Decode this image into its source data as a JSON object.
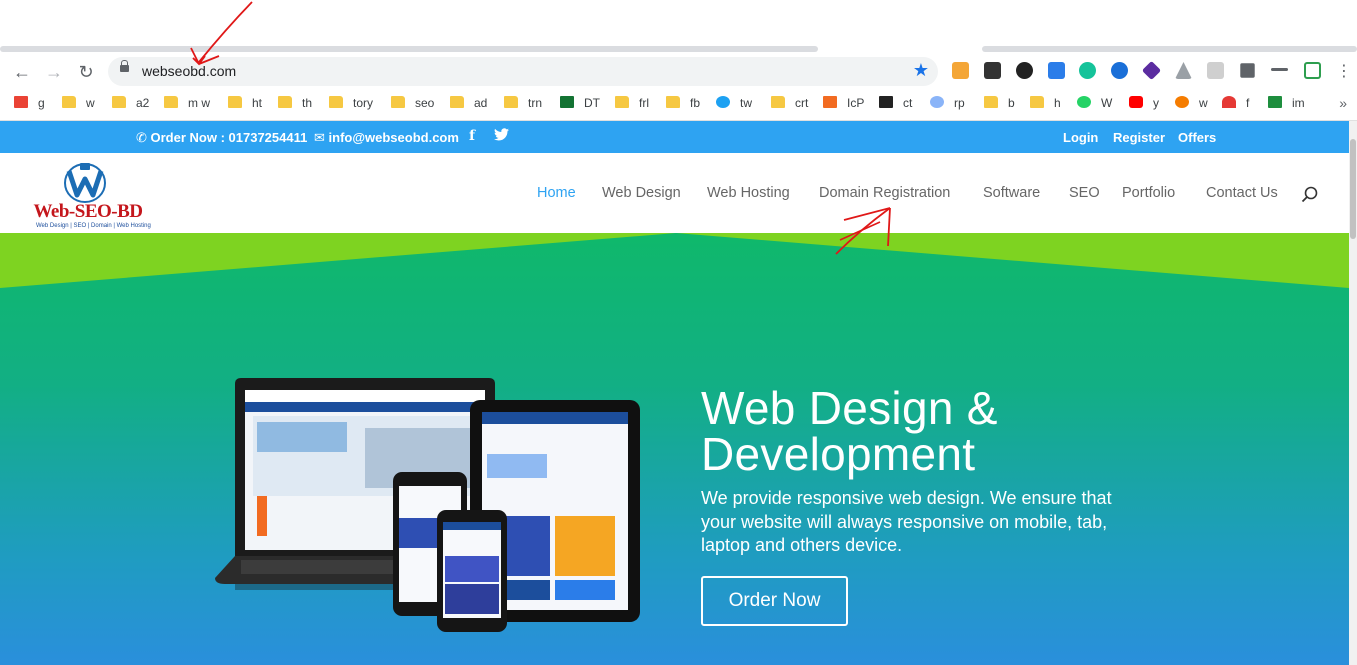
{
  "browser": {
    "url": "webseobd.com",
    "bookmarks": [
      {
        "label": "g",
        "kind": "gmail"
      },
      {
        "label": "w",
        "kind": "folder"
      },
      {
        "label": "a2",
        "kind": "folder"
      },
      {
        "label": "m w",
        "kind": "folder"
      },
      {
        "label": "ht",
        "kind": "folder"
      },
      {
        "label": "th",
        "kind": "folder"
      },
      {
        "label": "tory",
        "kind": "folder"
      },
      {
        "label": "seo",
        "kind": "folder"
      },
      {
        "label": "ad",
        "kind": "folder"
      },
      {
        "label": "trn",
        "kind": "folder"
      },
      {
        "label": "DT",
        "kind": "dt"
      },
      {
        "label": "frl",
        "kind": "folder"
      },
      {
        "label": "fb",
        "kind": "folder"
      },
      {
        "label": "tw",
        "kind": "twitter"
      },
      {
        "label": "crt",
        "kind": "folder"
      },
      {
        "label": "IcP",
        "kind": "loc"
      },
      {
        "label": "ct",
        "kind": "ct"
      },
      {
        "label": "rp",
        "kind": "rp"
      },
      {
        "label": "b",
        "kind": "folder"
      },
      {
        "label": "h",
        "kind": "folder"
      },
      {
        "label": "W",
        "kind": "whatsapp"
      },
      {
        "label": "y",
        "kind": "youtube"
      },
      {
        "label": "w",
        "kind": "w2"
      },
      {
        "label": "f",
        "kind": "speed"
      },
      {
        "label": "im",
        "kind": "im"
      }
    ]
  },
  "topbar": {
    "order": "Order Now : 01737254411",
    "email": "info@webseobd.com",
    "login": "Login",
    "register": "Register",
    "offers": "Offers"
  },
  "logo": {
    "name": "Web-SEO-BD",
    "tagline": "Web Design | SEO | Domain | Web Hosting"
  },
  "menu": {
    "home": "Home",
    "web_design": "Web Design",
    "web_hosting": "Web Hosting",
    "domain": "Domain Registration",
    "software": "Software",
    "seo": "SEO",
    "portfolio": "Portfolio",
    "contact": "Contact Us"
  },
  "hero": {
    "title_line1": "Web Design &",
    "title_line2": "Development",
    "text": "We provide responsive web design. We ensure that your website will always responsive on mobile, tab, laptop and others device.",
    "button": "Order Now"
  },
  "colors": {
    "accent": "#2ea3f2",
    "logo_red": "#c4161c",
    "hero_green": "#0fb86b",
    "hero_blue": "#2a8fdc"
  }
}
